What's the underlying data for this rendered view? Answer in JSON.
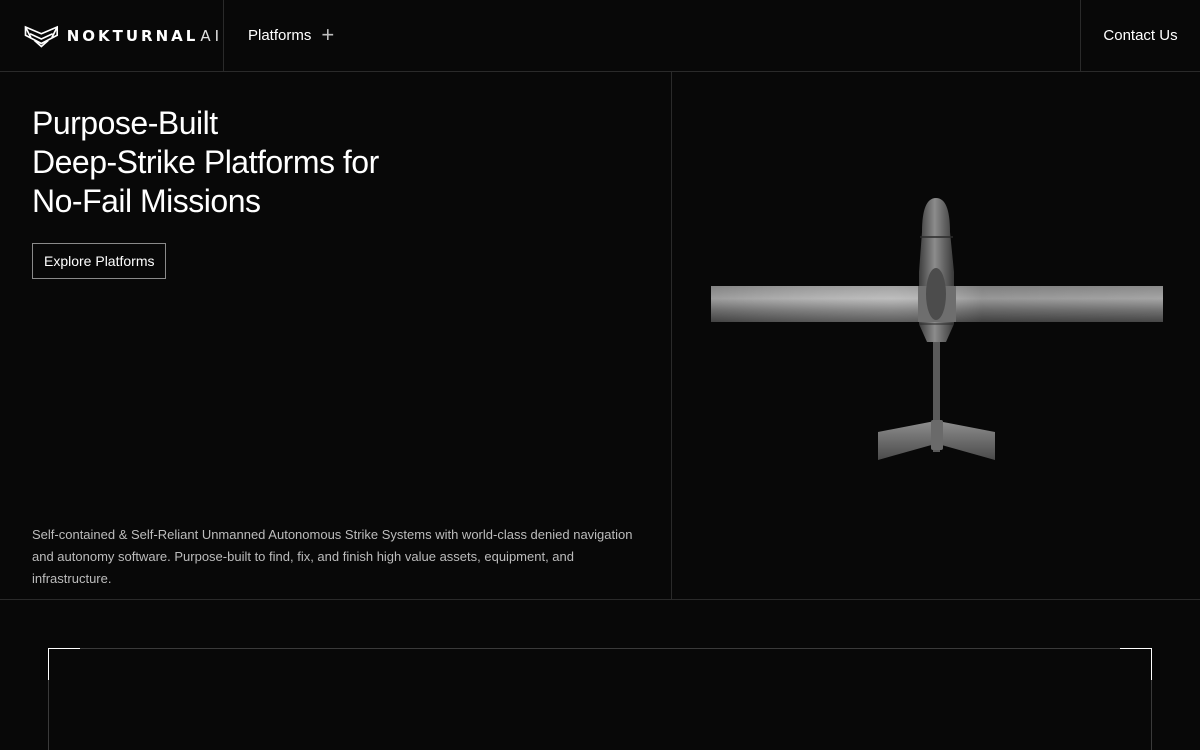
{
  "header": {
    "logo": {
      "brand": "NOKTURNAL",
      "suffix": "AI"
    },
    "nav": {
      "platforms_label": "Platforms",
      "platforms_icon": "plus-icon"
    },
    "contact_label": "Contact Us"
  },
  "hero": {
    "title_lines": [
      "Purpose-Built",
      "Deep-Strike Platforms for",
      "No-Fail Missions"
    ],
    "cta_label": "Explore Platforms",
    "description": "Self-contained & Self-Reliant Unmanned Autonomous Strike Systems with world-class denied navigation and autonomy software. Purpose-built to find, fix, and finish high value assets, equipment, and infrastructure.",
    "image": "fixed-wing-drone-top-view"
  },
  "colors": {
    "background": "#080808",
    "divider": "#2a2a2a",
    "text": "#ffffff",
    "muted_text": "#bcbcbc"
  }
}
